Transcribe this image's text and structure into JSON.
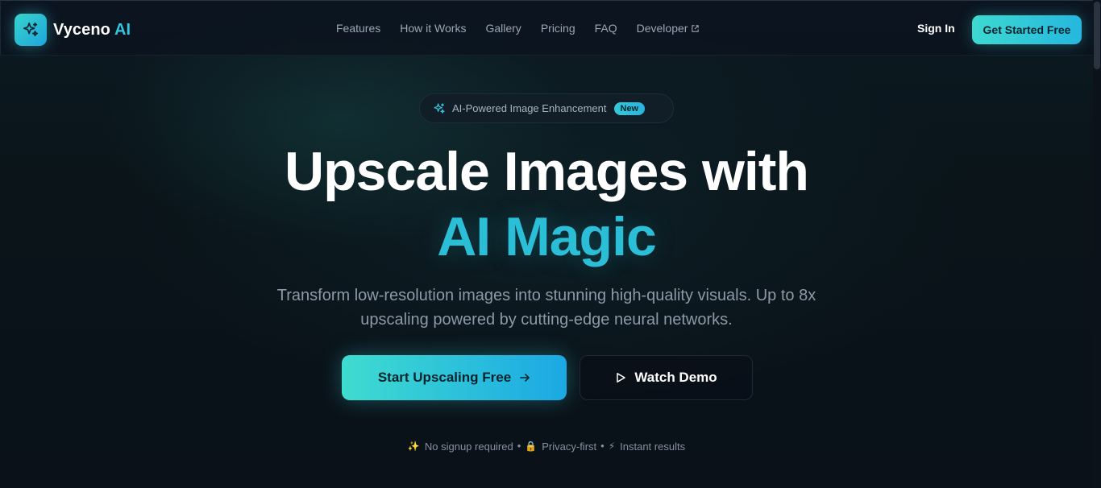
{
  "brand": {
    "name": "Vyceno",
    "accent": "AI",
    "logo_icon": "sparkles-icon"
  },
  "nav": {
    "links": [
      {
        "label": "Features"
      },
      {
        "label": "How it Works"
      },
      {
        "label": "Gallery"
      },
      {
        "label": "Pricing"
      },
      {
        "label": "FAQ"
      },
      {
        "label": "Developer",
        "icon": "external-link-icon"
      }
    ],
    "sign_in": "Sign In",
    "get_started": "Get Started Free"
  },
  "hero": {
    "badge": {
      "icon": "sparkles-icon",
      "text": "AI-Powered Image Enhancement",
      "tag": "New"
    },
    "headline": "Upscale Images with",
    "headline_accent": "AI Magic",
    "subtitle": "Transform low-resolution images into stunning high-quality visuals. Up to 8x upscaling powered by cutting-edge neural networks.",
    "primary_button": "Start Upscaling Free",
    "primary_icon": "arrow-right-icon",
    "secondary_button": "Watch Demo",
    "secondary_icon": "play-icon",
    "features": [
      {
        "icon": "✨",
        "text": "No signup required"
      },
      {
        "icon": "🔒",
        "text": "Privacy-first"
      },
      {
        "icon": "⚡",
        "text": "Instant results"
      }
    ],
    "separator": "•"
  },
  "colors": {
    "accent": "#2bbfd7",
    "gradient_start": "#3fdcd0",
    "gradient_end": "#1ba8e4",
    "background": "#0a111b"
  }
}
